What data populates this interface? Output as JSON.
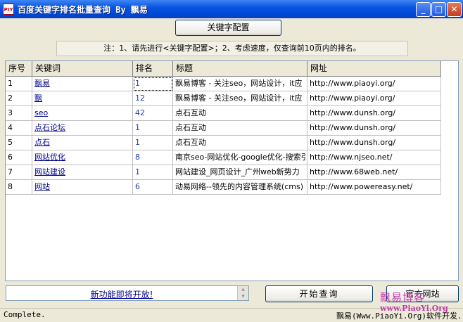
{
  "window": {
    "icon_text": "PIY",
    "title": "百度关键字排名批量查询 By 飘易",
    "min_glyph": "_",
    "max_glyph": "□",
    "close_glyph": "✕"
  },
  "config_button": "关键字配置",
  "notice": "注：1、请先进行<关键字配置>；2、考虑速度，仅查询前10页内的排名。",
  "table": {
    "columns": [
      "序号",
      "关键词",
      "排名",
      "标题",
      "网址"
    ],
    "rows": [
      {
        "idx": "1",
        "keyword": "飘易",
        "rank": "1",
        "title": "飘易博客 - 关注seo，网站设计，it应",
        "url": "http://www.piaoyi.org/"
      },
      {
        "idx": "2",
        "keyword": "飘",
        "rank": "12",
        "title": "飘易博客 - 关注seo，网站设计，it应",
        "url": "http://www.piaoyi.org/"
      },
      {
        "idx": "3",
        "keyword": "seo",
        "rank": "42",
        "title": "点石互动",
        "url": "http://www.dunsh.org/"
      },
      {
        "idx": "4",
        "keyword": "点石论坛",
        "rank": "1",
        "title": "点石互动",
        "url": "http://www.dunsh.org/"
      },
      {
        "idx": "5",
        "keyword": "点石",
        "rank": "1",
        "title": "点石互动",
        "url": "http://www.dunsh.org/"
      },
      {
        "idx": "6",
        "keyword": "网站优化",
        "rank": "8",
        "title": "南京seo-网站优化-google优化-搜索引",
        "url": "http://www.njseo.net/"
      },
      {
        "idx": "7",
        "keyword": "网站建设",
        "rank": "1",
        "title": "网站建设_网页设计_广州web新势力",
        "url": "http://www.68web.net/"
      },
      {
        "idx": "8",
        "keyword": "网站",
        "rank": "6",
        "title": "动易网络--领先的内容管理系统(cms)",
        "url": "http://www.powereasy.net/"
      }
    ]
  },
  "new_feature_text": "新功能即将开放!",
  "start_button": "开始查询",
  "official_button": "官方网站",
  "status_left": "Complete.",
  "status_right": "飘易(Www.PiaoYi.Org)软件开发.",
  "watermark": {
    "line1": "飘易博客",
    "line2": "www.PiaoYi.Org"
  }
}
